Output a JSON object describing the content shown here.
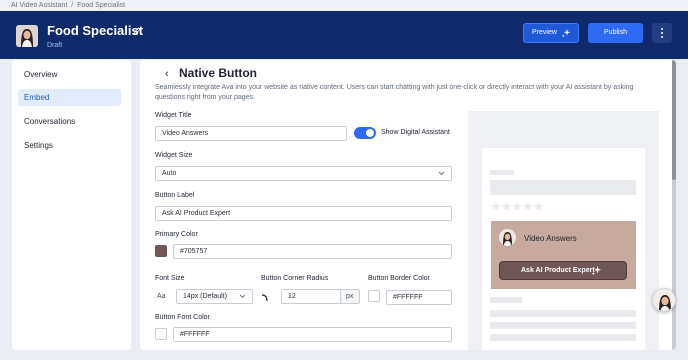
{
  "breadcrumb": {
    "items": [
      "AI Video Assistant",
      "Food Specialist"
    ],
    "separator": "/"
  },
  "header": {
    "title": "Food Specialist",
    "status": "Draft",
    "preview_label": "Preview",
    "publish_label": "Publish"
  },
  "sidebar": {
    "items": [
      {
        "label": "Overview"
      },
      {
        "label": "Embed",
        "active": true
      },
      {
        "label": "Conversations"
      },
      {
        "label": "Settings"
      }
    ]
  },
  "page": {
    "back_glyph": "‹",
    "title": "Native Button",
    "description": "Seamlessly integrate Ava into your website as native content. Users can start chatting with just one-click or directly interact with your AI assistant by asking questions right from your pages."
  },
  "form": {
    "widget_title": {
      "label": "Widget Title",
      "value": "Video Answers"
    },
    "show_assistant": {
      "label": "Show Digital Assistant",
      "on": true
    },
    "widget_size": {
      "label": "Widget Size",
      "value": "Auto"
    },
    "button_label": {
      "label": "Button Label",
      "value": "Ask AI Product Expert"
    },
    "primary_color": {
      "label": "Primary Color",
      "value": "#705757"
    },
    "font_size": {
      "label": "Font Size",
      "glyph": "Aa",
      "value": "14px (Default)"
    },
    "corner_radius": {
      "label": "Button Corner Radius",
      "value": "12",
      "unit": "px"
    },
    "border_color": {
      "label": "Button Border Color",
      "value": "#FFFFFF"
    },
    "font_color": {
      "label": "Button Font Color",
      "value": "#FFFFFF"
    }
  },
  "preview_widget": {
    "title": "Video Answers",
    "button_label": "Ask AI Product Expert",
    "rating_stars": "★★★★★"
  },
  "colors": {
    "header_bg": "#0e2a6b",
    "accent": "#2f6af2",
    "primary": "#705757",
    "widget_bg": "#c6a99f"
  }
}
